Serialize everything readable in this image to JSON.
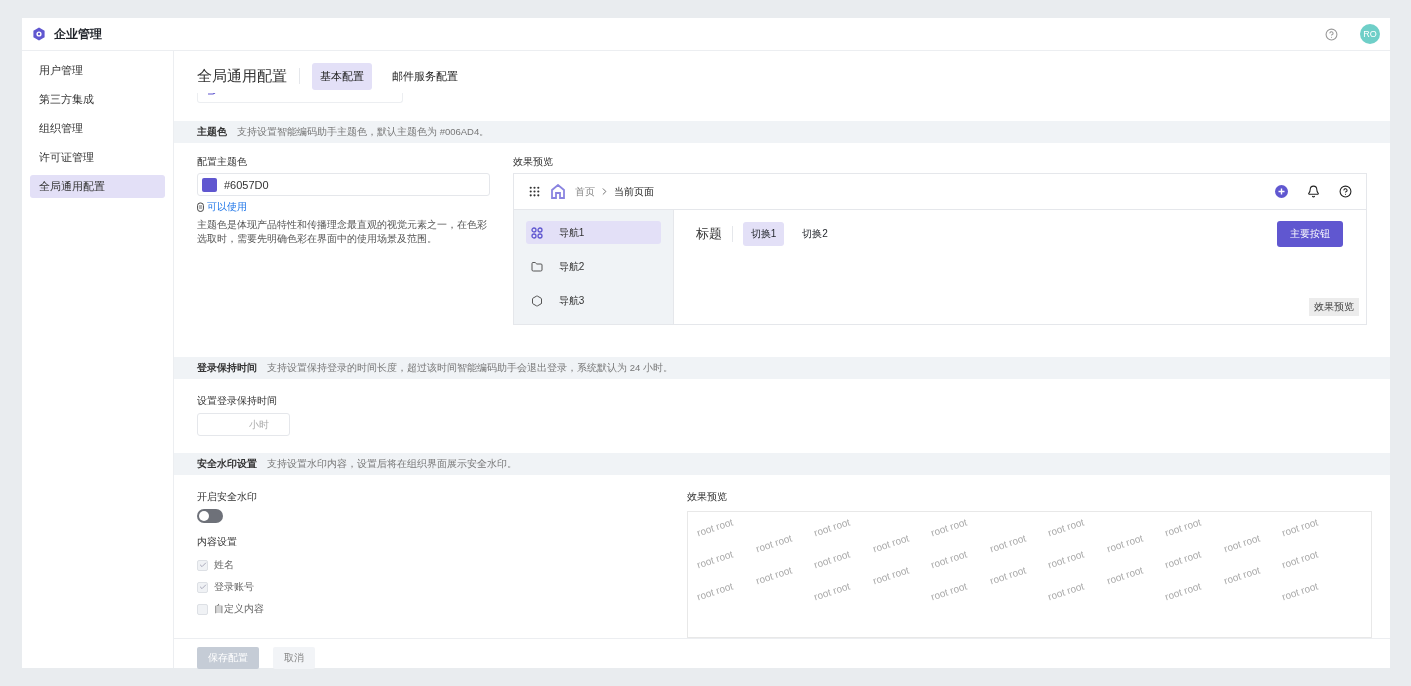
{
  "app": {
    "title": "企业管理",
    "avatar": "RO"
  },
  "sidebar": {
    "items": [
      {
        "label": "用户管理",
        "selected": false
      },
      {
        "label": "第三方集成",
        "selected": false
      },
      {
        "label": "组织管理",
        "selected": false
      },
      {
        "label": "许可证管理",
        "selected": false
      },
      {
        "label": "全局通用配置",
        "selected": true
      }
    ]
  },
  "page": {
    "title": "全局通用配置",
    "tabs": [
      {
        "label": "基本配置",
        "selected": true
      },
      {
        "label": "邮件服务配置",
        "selected": false
      }
    ]
  },
  "theme_section": {
    "title": "主题色",
    "description": "支持设置智能编码助手主题色，默认主题色为 #006AD4。",
    "field_label": "配置主题色",
    "color_value": "#6057D0",
    "status": "可以使用",
    "hint": "主题色是体现产品特性和传播理念最直观的视觉元素之一，在色彩选取时，需要先明确色彩在界面中的使用场景及范围。",
    "preview": {
      "label": "效果预览",
      "breadcrumb": [
        "首页",
        "当前页面"
      ],
      "nav": [
        {
          "label": "导航1",
          "selected": true
        },
        {
          "label": "导航2",
          "selected": false
        },
        {
          "label": "导航3",
          "selected": false
        }
      ],
      "heading": "标题",
      "tabs": [
        {
          "label": "切换1",
          "selected": true
        },
        {
          "label": "切换2",
          "selected": false
        }
      ],
      "primary_button": "主要按钮",
      "badge": "效果预览"
    }
  },
  "login_section": {
    "title": "登录保持时间",
    "description": "支持设置保持登录的时间长度，超过该时间智能编码助手会退出登录，系统默认为 24 小时。",
    "field_label": "设置登录保持时间",
    "unit": "小时"
  },
  "watermark_section": {
    "title": "安全水印设置",
    "description": "支持设置水印内容，设置后将在组织界面展示安全水印。",
    "toggle_label": "开启安全水印",
    "toggle": {
      "on": false
    },
    "content_label": "内容设置",
    "options": [
      {
        "label": "姓名",
        "checked": true,
        "disabled": true
      },
      {
        "label": "登录账号",
        "checked": true,
        "disabled": true
      },
      {
        "label": "自定义内容",
        "checked": false,
        "disabled": true
      }
    ],
    "preview_label": "效果预览",
    "watermark_rows": [
      [
        "root root",
        "root root",
        "root root",
        "root root",
        "root root",
        "root root"
      ],
      [
        "root root",
        "root root",
        "root root",
        "root root",
        "root root"
      ],
      [
        "root root",
        "root root",
        "root root",
        "root root",
        "root root",
        "root root"
      ],
      [
        "root root",
        "root root",
        "root root",
        "root root",
        "root root"
      ],
      [
        "root root",
        "root root",
        "root root",
        "root root",
        "root root",
        "root root"
      ]
    ]
  },
  "footer": {
    "buttons": [
      {
        "label": "保存配置",
        "kind": "primary",
        "disabled": true
      },
      {
        "label": "取消",
        "kind": "secondary"
      }
    ]
  }
}
